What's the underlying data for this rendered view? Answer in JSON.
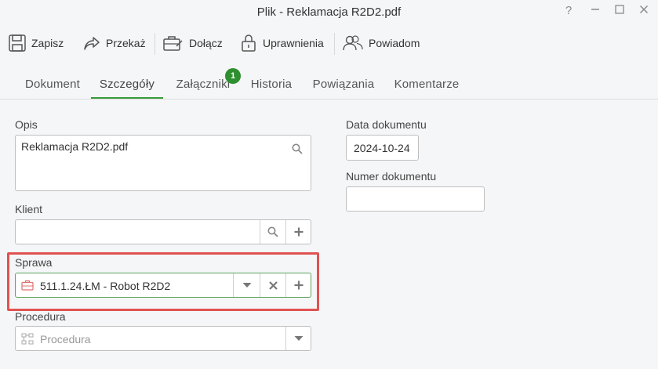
{
  "window": {
    "title": "Plik - Reklamacja R2D2.pdf",
    "help": "?",
    "minimize": "—",
    "maximize": "☐",
    "close": "✕"
  },
  "toolbar": {
    "save": "Zapisz",
    "forward": "Przekaż",
    "attach": "Dołącz",
    "permissions": "Uprawnienia",
    "notify": "Powiadom"
  },
  "tabs": {
    "document": "Dokument",
    "details": "Szczegóły",
    "attachments": "Załączniki",
    "attachments_badge": "1",
    "history": "Historia",
    "relations": "Powiązania",
    "comments": "Komentarze",
    "active": "details"
  },
  "form": {
    "description": {
      "label": "Opis",
      "value": "Reklamacja R2D2.pdf"
    },
    "client": {
      "label": "Klient",
      "value": ""
    },
    "case": {
      "label": "Sprawa",
      "value": "511.1.24.ŁM - Robot R2D2"
    },
    "procedure": {
      "label": "Procedura",
      "placeholder": "Procedura"
    },
    "document_date": {
      "label": "Data dokumentu",
      "value": "2024-10-24"
    },
    "document_number": {
      "label": "Numer dokumentu",
      "value": ""
    }
  },
  "colors": {
    "accent": "#3a9b3a",
    "badge": "#2e8f2e",
    "highlight": "#e05252",
    "case_icon": "#e07070"
  }
}
